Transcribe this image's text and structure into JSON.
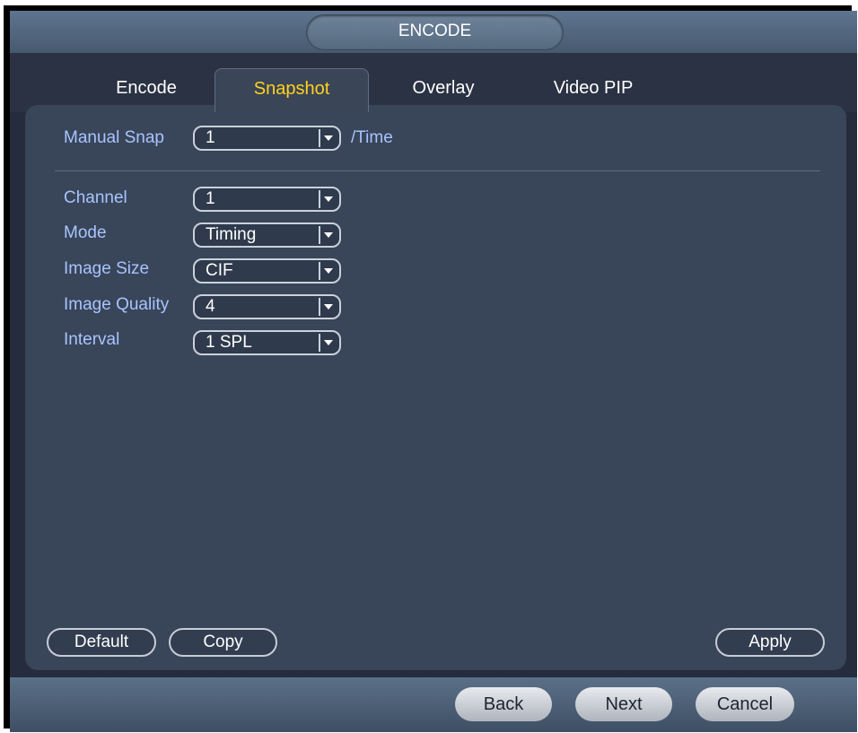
{
  "window": {
    "title": "ENCODE"
  },
  "tabs": [
    {
      "label": "Encode",
      "active": false
    },
    {
      "label": "Snapshot",
      "active": true
    },
    {
      "label": "Overlay",
      "active": false
    },
    {
      "label": "Video PIP",
      "active": false
    }
  ],
  "manual_snap": {
    "label": "Manual Snap",
    "value": "1",
    "suffix": "/Time"
  },
  "fields": {
    "channel": {
      "label": "Channel",
      "value": "1"
    },
    "mode": {
      "label": "Mode",
      "value": "Timing"
    },
    "image_size": {
      "label": "Image Size",
      "value": "CIF"
    },
    "image_quality": {
      "label": "Image Quality",
      "value": "4"
    },
    "interval": {
      "label": "Interval",
      "value": "1 SPL"
    }
  },
  "buttons": {
    "default": "Default",
    "copy": "Copy",
    "apply": "Apply"
  },
  "nav": {
    "back": "Back",
    "next": "Next",
    "cancel": "Cancel"
  },
  "colors": {
    "label": "#a8c4ff",
    "active_tab_text": "#ffd21e",
    "panel_bg": "#394558",
    "window_bg": "#242c3d"
  }
}
